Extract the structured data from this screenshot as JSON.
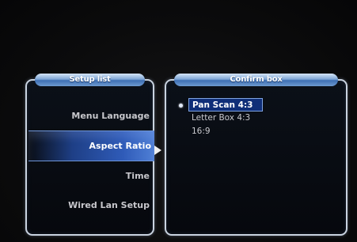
{
  "setup_panel": {
    "title": "Setup list",
    "items": [
      {
        "label": "Menu Language"
      },
      {
        "label": "Aspect Ratio"
      },
      {
        "label": "Time"
      },
      {
        "label": "Wired Lan Setup"
      }
    ],
    "selected": "Aspect Ratio"
  },
  "confirm_panel": {
    "title": "Confirm box",
    "options": [
      {
        "label": "Pan Scan 4:3"
      },
      {
        "label": "Letter Box 4:3"
      },
      {
        "label": "16:9"
      }
    ],
    "selected": "Pan Scan 4:3"
  },
  "icons": {
    "arrow": "triangle-right-icon",
    "bullet": "selection-dot-icon"
  },
  "colors": {
    "highlight": "#2f5bb8",
    "title_bar": "#5f8fcf",
    "border": "#c9d3e0",
    "background": "#0a0a0b"
  }
}
